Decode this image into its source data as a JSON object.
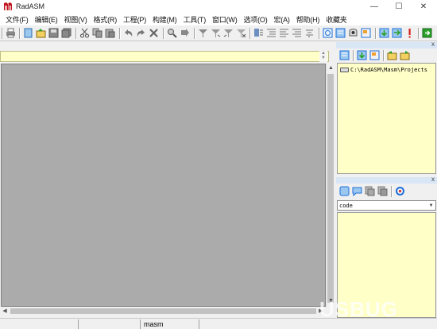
{
  "window": {
    "title": "RadASM",
    "minimize_glyph": "—",
    "maximize_glyph": "☐",
    "close_glyph": "✕"
  },
  "menu": [
    "文件(F)",
    "编辑(E)",
    "视图(V)",
    "格式(R)",
    "工程(P)",
    "构建(M)",
    "工具(T)",
    "窗口(W)",
    "选项(O)",
    "宏(A)",
    "帮助(H)",
    "收藏夹"
  ],
  "project_panel": {
    "close_glyph": "x",
    "tree_root": "C:\\RadASM\\Masm\\Projects"
  },
  "properties_panel": {
    "close_glyph": "x",
    "selector_value": "code"
  },
  "statusbar": {
    "assembler": "masm"
  },
  "watermark": "USBUG",
  "colors": {
    "panel_bg": "#ffffc8",
    "mdi_bg": "#ababab",
    "accent": "#1e6fd9"
  }
}
